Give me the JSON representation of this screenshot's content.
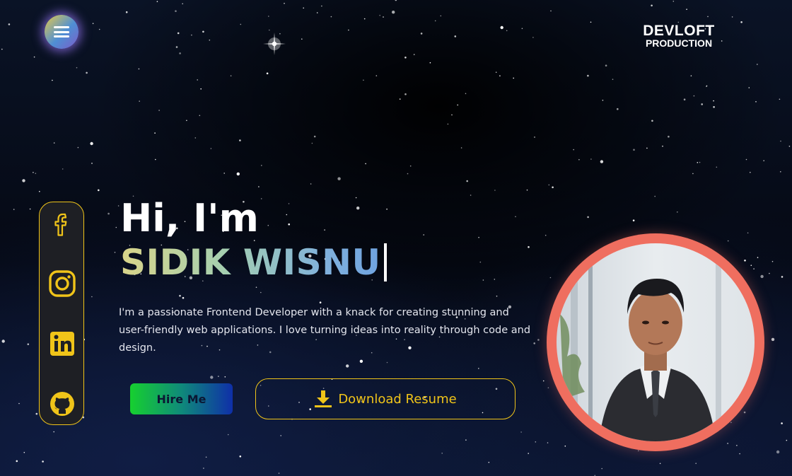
{
  "header": {
    "menu_icon": "hamburger-menu-icon",
    "brand_line1": "DEVLOFT",
    "brand_line2": "PRODUCTION"
  },
  "social": [
    {
      "name": "facebook",
      "icon": "facebook-icon"
    },
    {
      "name": "instagram",
      "icon": "instagram-icon"
    },
    {
      "name": "linkedin",
      "icon": "linkedin-icon"
    },
    {
      "name": "github",
      "icon": "github-icon"
    }
  ],
  "hero": {
    "greeting": "Hi, I'm",
    "name": "SIDIK WISNU",
    "description": "I'm a passionate Frontend Developer with a knack for creating stunning and user-friendly web applications. I love turning ideas into reality through code and design.",
    "hire_label": "Hire Me",
    "download_label": "Download Resume",
    "download_icon": "download-icon"
  },
  "profile": {
    "photo": "profile-photo"
  },
  "colors": {
    "accent_yellow": "#f0c419",
    "avatar_ring": "#ef6e5f",
    "hire_gradient_start": "#16d02f",
    "hire_gradient_end": "#0f2fa8"
  }
}
